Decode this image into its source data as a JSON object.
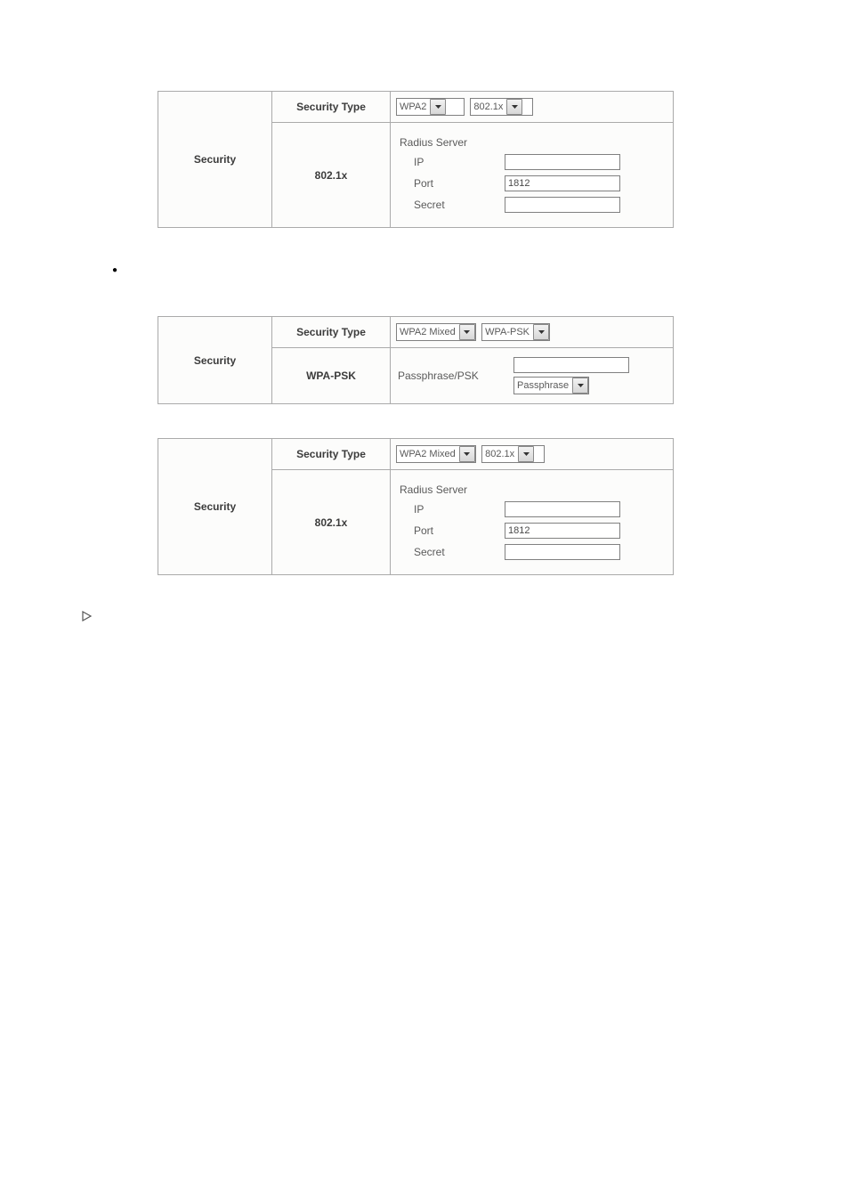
{
  "labels": {
    "security": "Security",
    "security_type": "Security Type"
  },
  "panel1": {
    "sel1": "WPA2",
    "sel2": "802.1x",
    "method_label": "802.1x",
    "radius_header": "Radius Server",
    "ip_label": "IP",
    "ip_value": "",
    "port_label": "Port",
    "port_value": "1812",
    "secret_label": "Secret",
    "secret_value": ""
  },
  "panel2": {
    "sel1": "WPA2 Mixed",
    "sel2": "WPA-PSK",
    "method_label": "WPA-PSK",
    "psk_label": "Passphrase/PSK",
    "psk_value": "",
    "psk_format": "Passphrase"
  },
  "panel3": {
    "sel1": "WPA2 Mixed",
    "sel2": "802.1x",
    "method_label": "802.1x",
    "radius_header": "Radius Server",
    "ip_label": "IP",
    "ip_value": "",
    "port_label": "Port",
    "port_value": "1812",
    "secret_label": "Secret",
    "secret_value": ""
  }
}
